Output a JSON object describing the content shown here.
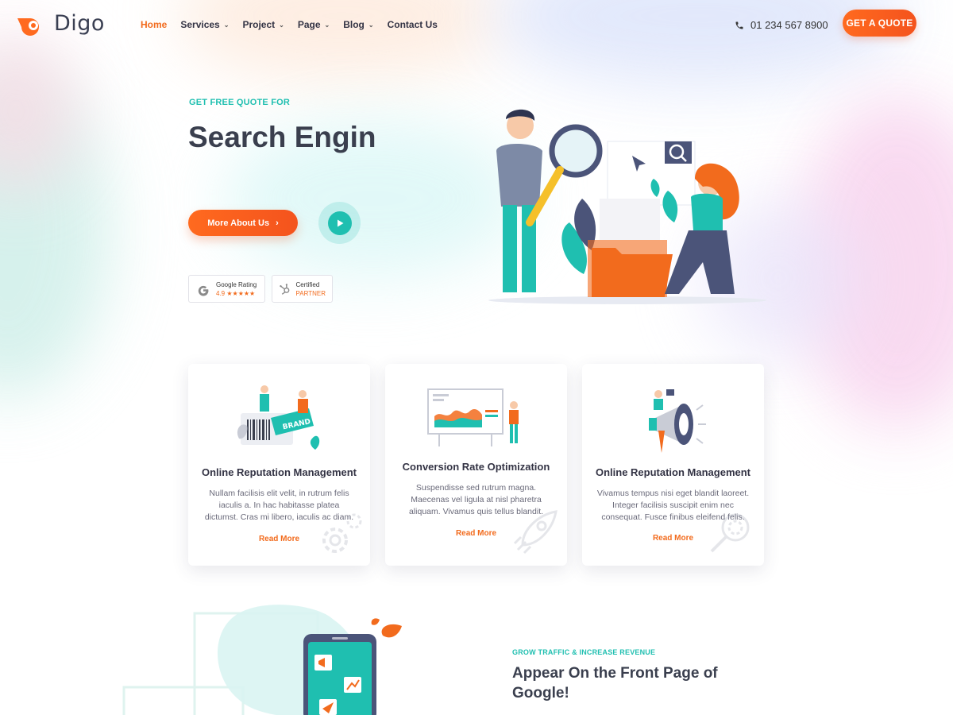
{
  "brand": {
    "name": "Digo"
  },
  "nav": {
    "items": [
      {
        "label": "Home",
        "active": true,
        "dropdown": false
      },
      {
        "label": "Services",
        "active": false,
        "dropdown": true
      },
      {
        "label": "Project",
        "active": false,
        "dropdown": true
      },
      {
        "label": "Page",
        "active": false,
        "dropdown": true
      },
      {
        "label": "Blog",
        "active": false,
        "dropdown": true
      },
      {
        "label": "Contact Us",
        "active": false,
        "dropdown": false
      }
    ],
    "phone": "01 234 567 8900",
    "cta_label": "GET A QUOTE"
  },
  "hero": {
    "eyebrow": "GET FREE QUOTE FOR",
    "title": "Search Engin",
    "button_label": "More About Us",
    "badges": [
      {
        "title": "Google Rating",
        "sub": "4.9 ★★★★★",
        "icon": "google-g-icon"
      },
      {
        "title": "Certified",
        "sub": "PARTNER",
        "icon": "hubspot-icon"
      }
    ]
  },
  "services": {
    "cards": [
      {
        "title": "Online Reputation Management",
        "desc": "Nullam facilisis elit velit, in rutrum felis iaculis a. In hac habitasse platea dictumst. Cras mi libero, iaculis ac diam.",
        "link": "Read More",
        "illus_label": "BRAND"
      },
      {
        "title": "Conversion Rate Optimization",
        "desc": "Suspendisse sed rutrum magna. Maecenas vel ligula at nisl pharetra aliquam. Vivamus quis tellus blandit.",
        "link": "Read More"
      },
      {
        "title": "Online Reputation Management",
        "desc": "Vivamus tempus nisi eget blandit laoreet. Integer facilisis suscipit enim nec consequat. Fusce finibus eleifend felis.",
        "link": "Read More"
      }
    ]
  },
  "feature": {
    "eyebrow": "GROW TRAFFIC & INCREASE REVENUE",
    "title": "Appear On the Front Page of Google!"
  },
  "colors": {
    "accent": "#f26b1d",
    "teal": "#1fbfb0",
    "heading": "#3a3f4e"
  }
}
